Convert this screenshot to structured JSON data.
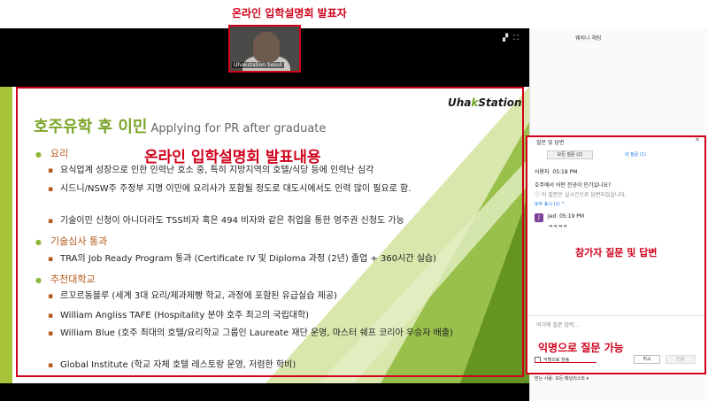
{
  "annotations": {
    "presenter": "온라인 입학설명회 발표자",
    "content": "온라인 입학설명회 발표내용",
    "participant_qa": "참가자 질문 및 답변",
    "anonymous_qa": "익명으로 질문 가능"
  },
  "video": {
    "presenter_name": "Uhakstation Seoul"
  },
  "slide": {
    "logo_prefix": "Uha",
    "logo_k": "k",
    "logo_suffix": "Station",
    "title_kr": "호주유학 후 이민",
    "title_en": "Applying for PR after graduate",
    "sections": [
      {
        "heading": "요리",
        "bullets": [
          "요식업계 성장으로 인한 인력난 호소 중, 특히 지방지역의 호텔/식당 등에 인력난 심각",
          "시드니/NSW주 주정부 지명 이민에 요리사가 포함될 정도로 대도시에서도 인력 많이 필요로 함.",
          "기술이민 신청이 아니더라도 TSS비자 혹은 494 비자와 같은 취업을 통한 영주권 신청도 가능"
        ]
      },
      {
        "heading": "기술심사 통과",
        "bullets": [
          "TRA의 Job Ready Program 통과 (Certificate IV 및 Diploma 과정 (2년) 졸업 + 360시간 실습)"
        ]
      },
      {
        "heading": "추천대학교",
        "bullets": [
          "르꼬르동블루 (세계 3대 요리/제과제빵 학교, 과정에 포함된 유급실습 제공)",
          "William Angliss TAFE (Hospitality 분야 호주 최고의 국립대학)",
          "William Blue (호주 최대의 호텔/요리학교 그룹인 Laureate 재단 운영, 마스터 쉐프 코리아 우승자 배출)",
          "Global Institute (학교 자체 호텔 레스토랑 운영, 저렴한 학비)"
        ]
      }
    ]
  },
  "right_panel": {
    "title": "웨비나 채팅"
  },
  "qa": {
    "title": "질문 및 답변",
    "tab_all": "모든 질문 (2)",
    "tab_mine": "내 질문 (1)",
    "q_user": "사용자",
    "q_time": "05:18 PM",
    "q_text": "호주에서 어떤 전공이 인기있나요?",
    "q_note": "이 질문은 실시간으로 답변되었습니다.",
    "q_link": "모두 표시 (1) ^",
    "a_user": "Jed",
    "a_time": "05:19 PM",
    "a_text": "ㅋㅋㅋㅋ",
    "a_avatar": "J",
    "input_placeholder": "여기에 질문 입력...",
    "anon_checkbox": "익명으로 전송",
    "cancel": "취소",
    "send": "전송",
    "sendto": "받는 사람:  모든 패널리스트 ▾"
  },
  "colors": {
    "annotation_red": "#d0021b",
    "title_green": "#7ba428",
    "section_orange": "#b5581c",
    "zoom_blue": "#0e72ed"
  }
}
